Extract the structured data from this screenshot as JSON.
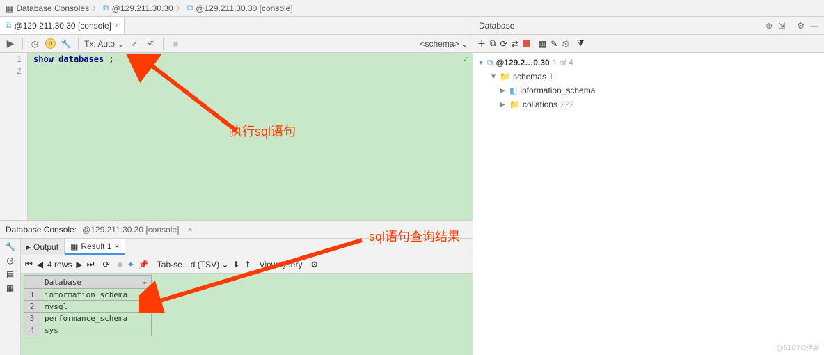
{
  "breadcrumb": {
    "item1": "Database Consoles",
    "item2": "@129.211.30.30",
    "item3": "@129.211.30.30 [console]"
  },
  "editor": {
    "tab_label": "@129.211.30.30 [console]",
    "tx_label": "Tx: Auto",
    "schema_label": "<schema>",
    "lines": {
      "l1": "1",
      "l2": "2"
    },
    "code_kw1": "show",
    "code_kw2": "databases",
    "code_punct": ";"
  },
  "annotations": {
    "exec_sql": "执行sql语句",
    "result_label": "sql语句查询结果"
  },
  "console": {
    "title": "Database Console:",
    "sub": "@129.211.30.30 [console]",
    "output_tab": "Output",
    "result_tab": "Result 1",
    "rows_label": "4 rows",
    "export_label": "Tab-se…d (TSV)",
    "view_query": "View Query"
  },
  "grid": {
    "column": "Database",
    "rows": [
      "information_schema",
      "mysql",
      "performance_schema",
      "sys"
    ]
  },
  "database_panel": {
    "title": "Database",
    "root": "@129.2…0.30",
    "root_count": "1 of 4",
    "schemas_label": "schemas",
    "schemas_count": "1",
    "info_schema": "information_schema",
    "collations": "collations",
    "collations_count": "222"
  },
  "watermark": "@51CTO博客"
}
